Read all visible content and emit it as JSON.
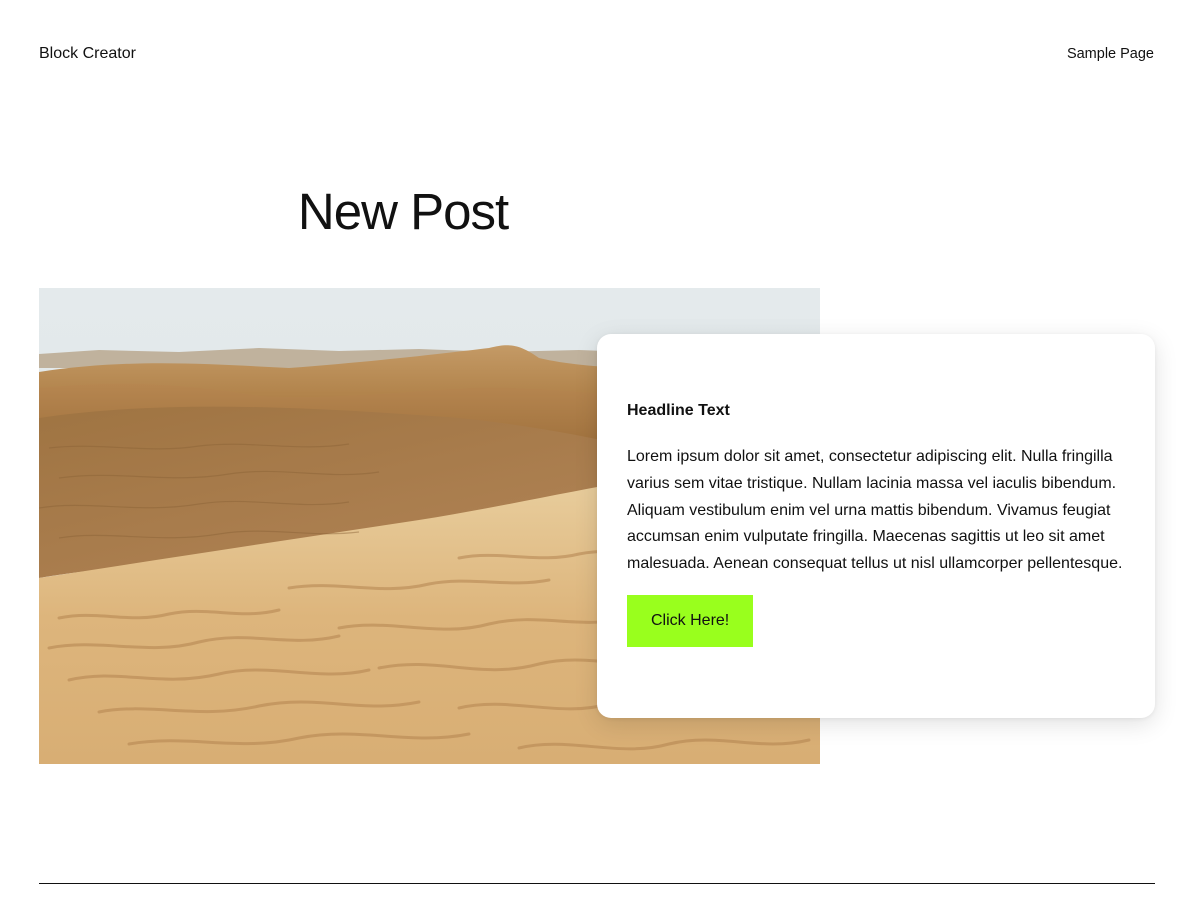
{
  "header": {
    "site_title": "Block Creator",
    "nav_link": "Sample Page"
  },
  "post": {
    "title": "New Post"
  },
  "hero": {
    "image_subject": "desert-dunes-photo"
  },
  "card": {
    "headline": "Headline Text",
    "body": "Lorem ipsum dolor sit amet, consectetur adipiscing elit. Nulla fringilla varius sem vitae tristique. Nullam lacinia massa vel iaculis bibendum. Aliquam vestibulum enim vel urna mattis bibendum. Vivamus feugiat accumsan enim vulputate fringilla. Maecenas sagittis ut leo sit amet malesuada. Aenean consequat tellus ut nisl ullamcorper pellentesque.",
    "button_label": "Click Here!",
    "button_color": "#99ff1d"
  }
}
